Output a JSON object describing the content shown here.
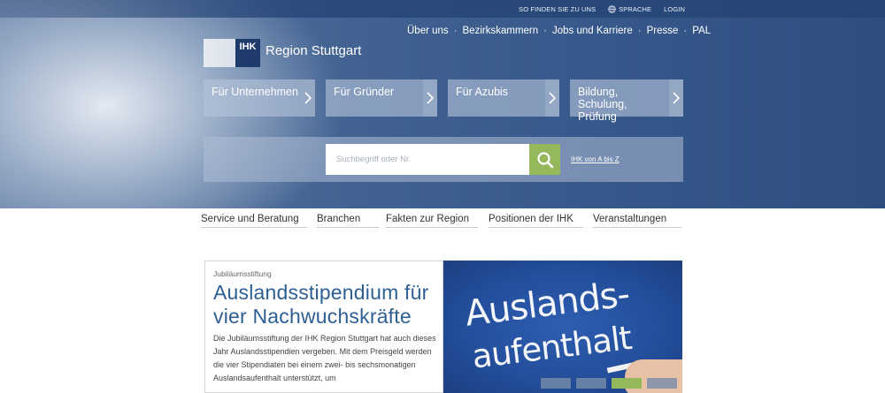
{
  "topbar": {
    "links": [
      "SO FINDEN SIE ZU UNS",
      "SPRACHE",
      "LOGIN"
    ]
  },
  "mainnav": {
    "items": [
      "Über uns",
      "Bezirkskammern",
      "Jobs und Karriere",
      "Presse",
      "PAL"
    ],
    "separator": "·"
  },
  "logo": {
    "mark": "IHK",
    "text": "Region Stuttgart"
  },
  "tiles": [
    {
      "label": "Für Unternehmen"
    },
    {
      "label": "Für Gründer"
    },
    {
      "label": "Für Azubis"
    },
    {
      "label": "Bildung, Schulung, Prüfung"
    }
  ],
  "search": {
    "placeholder": "Suchbegriff oder Nr.",
    "az_link": "IHK von A bis Z"
  },
  "subnav": {
    "items": [
      "Service und Beratung",
      "Branchen",
      "Fakten zur Region",
      "Positionen der IHK",
      "Veranstaltungen"
    ]
  },
  "article": {
    "kicker": "Jubiläumsstiftung",
    "title": "Auslandsstipendium für vier Nachwuchskräfte",
    "body": "Die Jubiläumsstiftung der IHK Region Stuttgart hat auch dieses Jahr Auslandsstipendien vergeben. Mit dem Preisgeld werden die vier Stipendiaten bei einem zwei- bis sechsmonatigen Auslandsaufenthalt unterstützt, um"
  },
  "promo_image": {
    "line1": "Auslands-",
    "line2": "aufenthalt"
  },
  "colors": {
    "accent_green": "#95b85a",
    "brand_blue": "#1e3b6c",
    "headline_blue": "#2e5f93"
  },
  "icons": {
    "language": "globe-icon",
    "search": "search-icon",
    "tile_arrow": "chevron-right-icon"
  }
}
